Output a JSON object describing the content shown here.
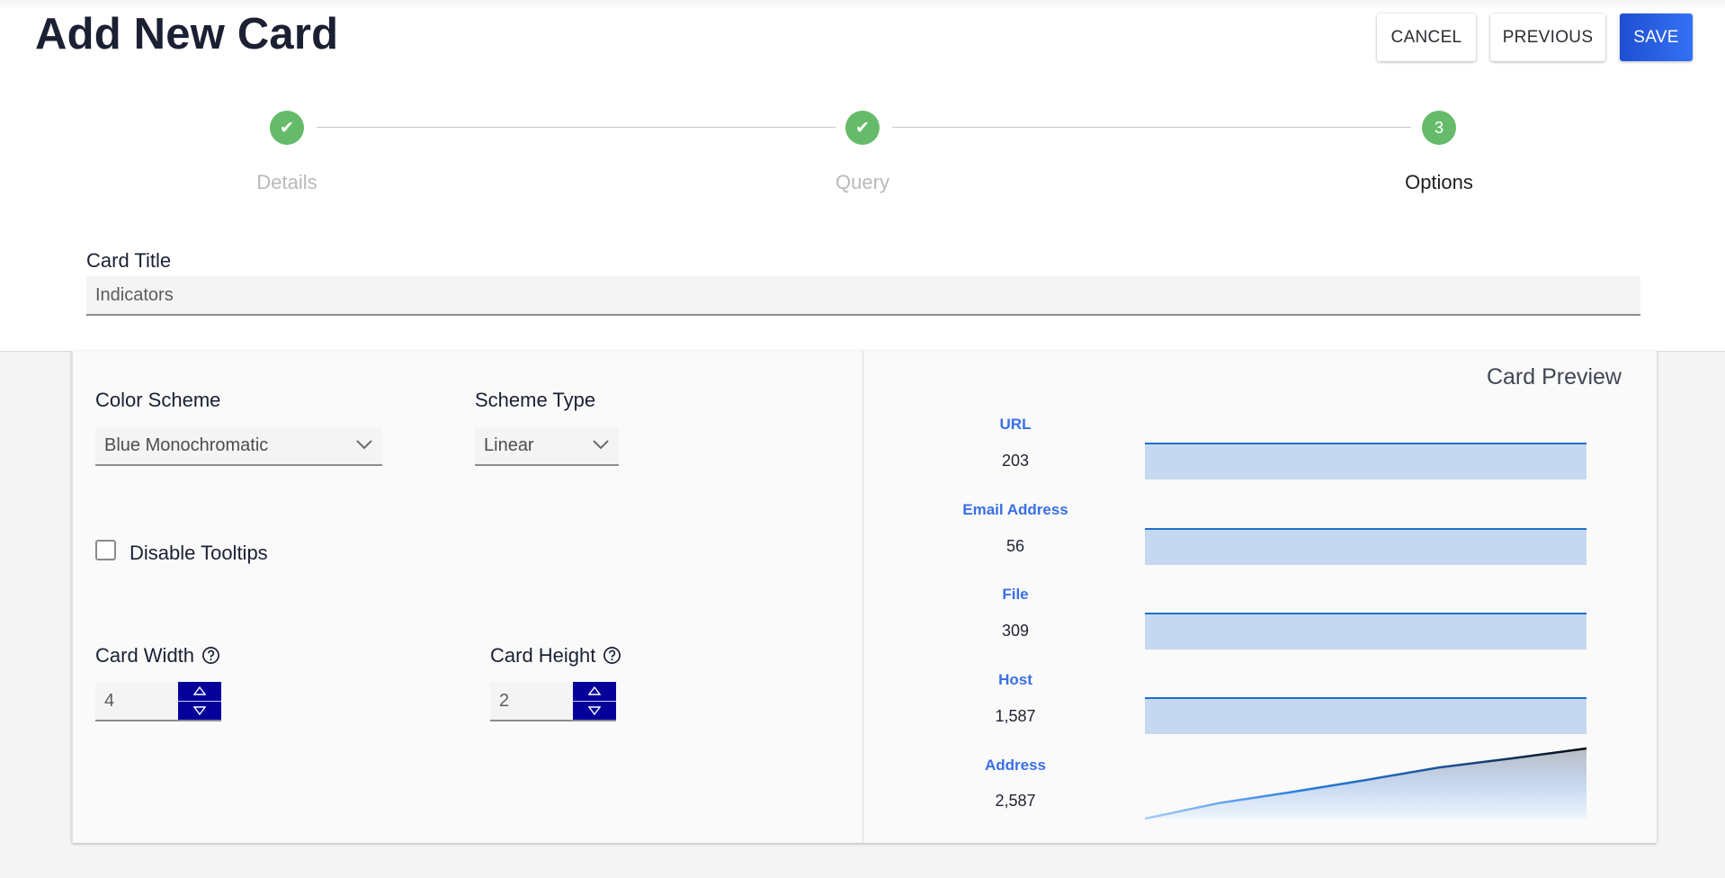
{
  "header": {
    "title": "Add New Card",
    "buttons": {
      "cancel": "CANCEL",
      "previous": "PREVIOUS",
      "save": "SAVE"
    }
  },
  "stepper": {
    "steps": [
      {
        "label": "Details",
        "state": "complete",
        "glyph": "✔"
      },
      {
        "label": "Query",
        "state": "complete",
        "glyph": "✔"
      },
      {
        "label": "Options",
        "state": "active",
        "glyph": "3"
      }
    ]
  },
  "card_title": {
    "label": "Card Title",
    "value": "Indicators"
  },
  "options": {
    "color_scheme": {
      "label": "Color Scheme",
      "value": "Blue Monochromatic"
    },
    "scheme_type": {
      "label": "Scheme Type",
      "value": "Linear"
    },
    "disable_tooltips": {
      "label": "Disable Tooltips",
      "checked": false
    },
    "card_width": {
      "label": "Card Width",
      "value": "4"
    },
    "card_height": {
      "label": "Card Height",
      "value": "2"
    }
  },
  "preview": {
    "title": "Card Preview",
    "indicators": [
      {
        "label": "URL",
        "value": "203"
      },
      {
        "label": "Email Address",
        "value": "56"
      },
      {
        "label": "File",
        "value": "309"
      },
      {
        "label": "Host",
        "value": "1,587"
      },
      {
        "label": "Address",
        "value": "2,587"
      }
    ],
    "sparkline_trend": [
      0,
      0.22,
      0.38,
      0.55,
      0.73,
      0.86,
      1.0
    ]
  },
  "colors": {
    "primary": "#2f63e8",
    "step_complete": "#66bb6a",
    "spinner": "#06009a",
    "indicator_label": "#3a6fe6",
    "bar_fill": "#c5d8f0",
    "bar_line": "#1f6fce"
  }
}
